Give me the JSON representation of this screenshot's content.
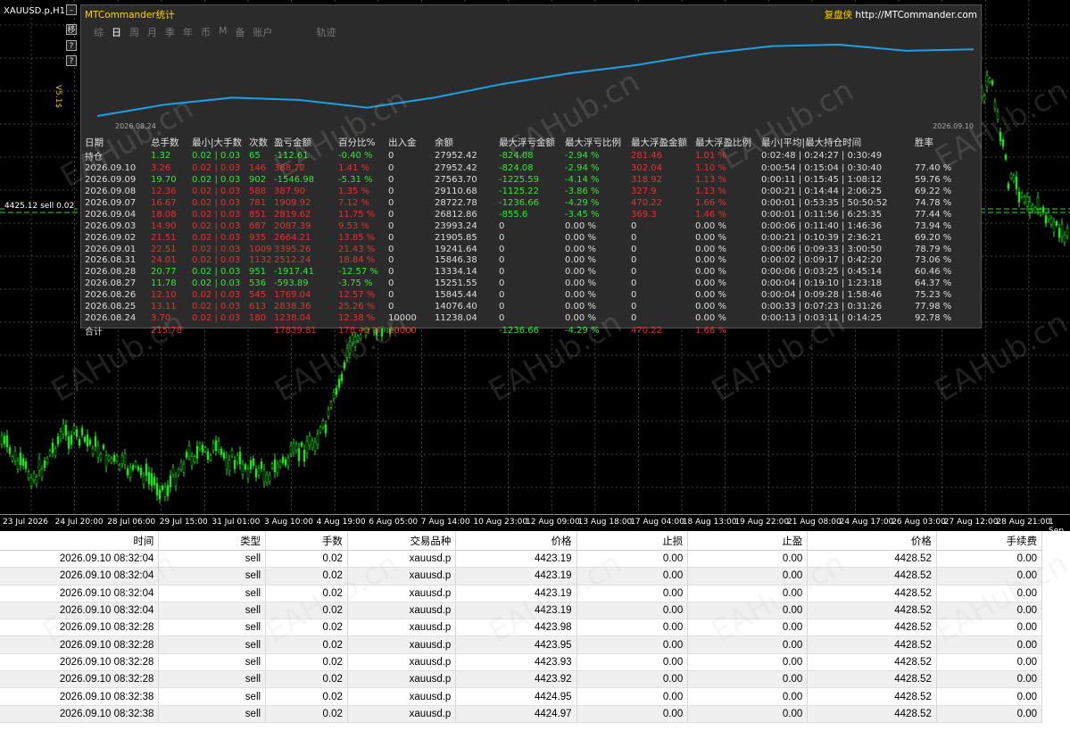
{
  "chart": {
    "symbol_label": "XAUUSD.p,H1",
    "version_tag": "V5.1$",
    "price_tag": "4425.12 sell 0.02",
    "x_axis_labels": [
      "23 Jul 2026",
      "24 Jul 20:00",
      "28 Jul 06:00",
      "29 Jul 15:00",
      "31 Jul 01:00",
      "3 Aug 10:00",
      "4 Aug 19:00",
      "6 Aug 05:00",
      "7 Aug 14:00",
      "10 Aug 23:00",
      "12 Aug 09:00",
      "13 Aug 18:00",
      "17 Aug 04:00",
      "18 Aug 13:00",
      "19 Aug 22:00",
      "21 Aug 08:00",
      "24 Aug 17:00",
      "26 Aug 03:00",
      "27 Aug 12:00",
      "28 Aug 21:00",
      "1 Sep"
    ],
    "left_buttons": [
      "移",
      "?",
      "?",
      "↑"
    ]
  },
  "stats": {
    "title": "MTCommander统计",
    "brand_cn": "复盘侠",
    "brand_url": "http://MTCommander.com",
    "tabs": [
      "综",
      "日",
      "周",
      "月",
      "季",
      "年",
      "币",
      "M",
      "备",
      "账户"
    ],
    "active_tab": "日",
    "traj_label": "轨迹",
    "curve_start_date": "2026.08.24",
    "curve_end_date": "2026.09.10",
    "headers": [
      "日期",
      "总手数",
      "最小|大手数",
      "次数",
      "盈亏金额",
      "百分比%",
      "出入金",
      "余额",
      "最大浮亏金额",
      "最大浮亏比例",
      "最大浮盈金额",
      "最大浮盈比例",
      "最小|平均|最大持仓时间",
      "胜率"
    ],
    "rows": [
      {
        "c": "g",
        "v": [
          "持仓",
          "1.32",
          "0.02 | 0.03",
          "65",
          "-112.61",
          "-0.40 %",
          "0",
          "27952.42",
          "-824.08",
          "-2.94 %",
          "281.46",
          "1.01 %",
          "0:02:48 | 0:24:27 | 0:30:49",
          ""
        ]
      },
      {
        "c": "r",
        "v": [
          "2026.09.10",
          "3.26",
          "0.02 | 0.03",
          "146",
          "388.72",
          "1.41 %",
          "0",
          "27952.42",
          "-824.08",
          "-2.94 %",
          "302.04",
          "1.10 %",
          "0:00:54 | 0:15:04 | 0:30:40",
          "77.40 %"
        ]
      },
      {
        "c": "g",
        "v": [
          "2026.09.09",
          "19.70",
          "0.02 | 0.03",
          "902",
          "-1546.98",
          "-5.31 %",
          "0",
          "27563.70",
          "-1225.59",
          "-4.14 %",
          "318.92",
          "1.13 %",
          "0:00:11 | 0:15:45 | 1:08:12",
          "59.76 %"
        ]
      },
      {
        "c": "r",
        "v": [
          "2026.09.08",
          "12.36",
          "0.02 | 0.03",
          "588",
          "387.90",
          "1.35 %",
          "0",
          "29110.68",
          "-1125.22",
          "-3.86 %",
          "327.9",
          "1.13 %",
          "0:00:21 | 0:14:44 | 2:06:25",
          "69.22 %"
        ]
      },
      {
        "c": "r",
        "v": [
          "2026.09.07",
          "16.67",
          "0.02 | 0.03",
          "781",
          "1909.92",
          "7.12 %",
          "0",
          "28722.78",
          "-1236.66",
          "-4.29 %",
          "470.22",
          "1.66 %",
          "0:00:01 | 0:53:35 | 50:50:52",
          "74.78 %"
        ]
      },
      {
        "c": "r",
        "v": [
          "2026.09.04",
          "18.08",
          "0.02 | 0.03",
          "851",
          "2819.62",
          "11.75 %",
          "0",
          "26812.86",
          "-855.6",
          "-3.45 %",
          "369.3",
          "1.46 %",
          "0:00:01 | 0:11:56 | 6:25:35",
          "77.44 %"
        ]
      },
      {
        "c": "r",
        "v": [
          "2026.09.03",
          "14.90",
          "0.02 | 0.03",
          "687",
          "2087.39",
          "9.53 %",
          "0",
          "23993.24",
          "0",
          "0.00 %",
          "0",
          "0.00 %",
          "0:00:06 | 0:11:40 | 1:46:36",
          "73.94 %"
        ]
      },
      {
        "c": "r",
        "v": [
          "2026.09.02",
          "21.51",
          "0.02 | 0.03",
          "935",
          "2664.21",
          "13.85 %",
          "0",
          "21905.85",
          "0",
          "0.00 %",
          "0",
          "0.00 %",
          "0:00:21 | 0:10:39 | 2:36:21",
          "69.20 %"
        ]
      },
      {
        "c": "r",
        "v": [
          "2026.09.01",
          "22.51",
          "0.02 | 0.03",
          "1009",
          "3395.26",
          "21.43 %",
          "0",
          "19241.64",
          "0",
          "0.00 %",
          "0",
          "0.00 %",
          "0:00:06 | 0:09:33 | 3:00:50",
          "78.79 %"
        ]
      },
      {
        "c": "r",
        "v": [
          "2026.08.31",
          "24.01",
          "0.02 | 0.03",
          "1132",
          "2512.24",
          "18.84 %",
          "0",
          "15846.38",
          "0",
          "0.00 %",
          "0",
          "0.00 %",
          "0:00:02 | 0:09:17 | 0:42:20",
          "73.06 %"
        ]
      },
      {
        "c": "g",
        "v": [
          "2026.08.28",
          "20.77",
          "0.02 | 0.03",
          "951",
          "-1917.41",
          "-12.57 %",
          "0",
          "13334.14",
          "0",
          "0.00 %",
          "0",
          "0.00 %",
          "0:00:06 | 0:03:25 | 0:45:14",
          "60.46 %"
        ]
      },
      {
        "c": "g",
        "v": [
          "2026.08.27",
          "11.78",
          "0.02 | 0.03",
          "536",
          "-593.89",
          "-3.75 %",
          "0",
          "15251.55",
          "0",
          "0.00 %",
          "0",
          "0.00 %",
          "0:00:04 | 0:19:10 | 1:23:18",
          "64.37 %"
        ]
      },
      {
        "c": "r",
        "v": [
          "2026.08.26",
          "12.10",
          "0.02 | 0.03",
          "545",
          "1769.04",
          "12.57 %",
          "0",
          "15845.44",
          "0",
          "0.00 %",
          "0",
          "0.00 %",
          "0:00:04 | 0:09:28 | 1:58:46",
          "75.23 %"
        ]
      },
      {
        "c": "r",
        "v": [
          "2026.08.25",
          "13.11",
          "0.02 | 0.03",
          "613",
          "2838.36",
          "25.26 %",
          "0",
          "14076.40",
          "0",
          "0.00 %",
          "0",
          "0.00 %",
          "0:00:33 | 0:07:23 | 0:31:26",
          "77.98 %"
        ]
      },
      {
        "c": "r",
        "v": [
          "2026.08.24",
          "3.70",
          "0.02 | 0.03",
          "180",
          "1238.04",
          "12.38 %",
          "10000",
          "11238.04",
          "0",
          "0.00 %",
          "0",
          "0.00 %",
          "0:00:13 | 0:03:11 | 0:14:25",
          "92.78 %"
        ]
      }
    ],
    "total": {
      "label": "合计",
      "lots": "215.78",
      "profit": "17839.81",
      "pct": "178.40 %",
      "cash": "10000",
      "max_float_loss": "-1236.66",
      "max_float_loss_pct": "-4.29 %",
      "max_float_profit": "470.22",
      "max_float_profit_pct": "1.66 %"
    }
  },
  "orders": {
    "columns": [
      "时间",
      "类型",
      "手数",
      "交易品种",
      "价格",
      "止损",
      "止盈",
      "价格",
      "手续费"
    ],
    "rows": [
      [
        "2026.09.10 08:32:04",
        "sell",
        "0.02",
        "xauusd.p",
        "4423.19",
        "0.00",
        "0.00",
        "4428.52",
        "0.00"
      ],
      [
        "2026.09.10 08:32:04",
        "sell",
        "0.02",
        "xauusd.p",
        "4423.19",
        "0.00",
        "0.00",
        "4428.52",
        "0.00"
      ],
      [
        "2026.09.10 08:32:04",
        "sell",
        "0.02",
        "xauusd.p",
        "4423.19",
        "0.00",
        "0.00",
        "4428.52",
        "0.00"
      ],
      [
        "2026.09.10 08:32:04",
        "sell",
        "0.02",
        "xauusd.p",
        "4423.19",
        "0.00",
        "0.00",
        "4428.52",
        "0.00"
      ],
      [
        "2026.09.10 08:32:28",
        "sell",
        "0.02",
        "xauusd.p",
        "4423.98",
        "0.00",
        "0.00",
        "4428.52",
        "0.00"
      ],
      [
        "2026.09.10 08:32:28",
        "sell",
        "0.02",
        "xauusd.p",
        "4423.95",
        "0.00",
        "0.00",
        "4428.52",
        "0.00"
      ],
      [
        "2026.09.10 08:32:28",
        "sell",
        "0.02",
        "xauusd.p",
        "4423.93",
        "0.00",
        "0.00",
        "4428.52",
        "0.00"
      ],
      [
        "2026.09.10 08:32:28",
        "sell",
        "0.02",
        "xauusd.p",
        "4423.92",
        "0.00",
        "0.00",
        "4428.52",
        "0.00"
      ],
      [
        "2026.09.10 08:32:38",
        "sell",
        "0.02",
        "xauusd.p",
        "4424.95",
        "0.00",
        "0.00",
        "4428.52",
        "0.00"
      ],
      [
        "2026.09.10 08:32:38",
        "sell",
        "0.02",
        "xauusd.p",
        "4424.97",
        "0.00",
        "0.00",
        "4428.52",
        "0.00"
      ]
    ]
  },
  "watermark": "EAHub.cn",
  "colors": {
    "up": "#33e633",
    "down": "#e63030",
    "curve": "#1ea0e6",
    "panel": "#2b2b2b"
  }
}
